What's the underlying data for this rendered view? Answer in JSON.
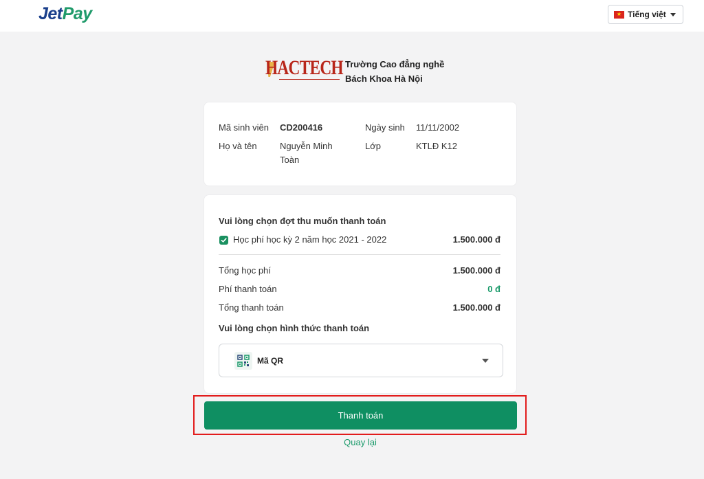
{
  "header": {
    "logo_part1": "Jet",
    "logo_part2": "Pay",
    "language": "Tiếng việt",
    "flag_icon": "vietnam-flag-icon"
  },
  "school": {
    "logo_text": "HACTECH",
    "name_line1": "Trường Cao đẳng nghề",
    "name_line2": "Bách Khoa Hà Nội"
  },
  "student": {
    "id_label": "Mã sinh viên",
    "id_value": "CD200416",
    "dob_label": "Ngày sinh",
    "dob_value": "11/11/2002",
    "name_label": "Họ và tên",
    "name_value_line1": "Nguyễn Minh",
    "name_value_line2": "Toàn",
    "class_label": "Lớp",
    "class_value": "KTLĐ K12"
  },
  "payment": {
    "choose_period_title": "Vui lòng chọn đợt thu muốn thanh toán",
    "fee_item": {
      "label": "Học phí học kỳ 2 năm học 2021 - 2022",
      "amount": "1.500.000 đ",
      "checked": true
    },
    "total_fee_label": "Tổng học phí",
    "total_fee_value": "1.500.000 đ",
    "payment_fee_label": "Phí thanh toán",
    "payment_fee_value": "0 đ",
    "total_payment_label": "Tổng thanh toán",
    "total_payment_value": "1.500.000 đ",
    "choose_method_title": "Vui lòng chọn hình thức thanh toán",
    "method_selected": "Mã QR",
    "method_icon": "qr-code-icon"
  },
  "actions": {
    "pay_button": "Thanh toán",
    "back_link": "Quay lại"
  },
  "colors": {
    "primary_green": "#0f8f62",
    "accent_green": "#1a9a6a",
    "brand_blue": "#1a3f8b",
    "highlight_red": "#e21c1c"
  }
}
